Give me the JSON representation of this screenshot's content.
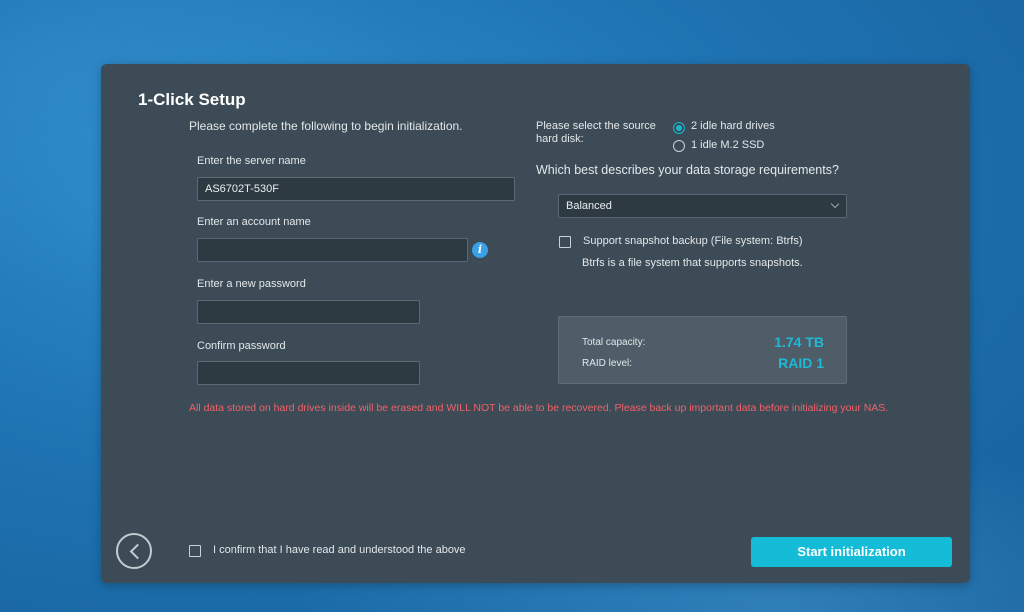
{
  "dialog": {
    "title": "1-Click Setup",
    "intro": "Please complete the following to begin initialization."
  },
  "form": {
    "server_name_label": "Enter the server name",
    "server_name_value": "AS6702T-530F",
    "account_name_label": "Enter an account name",
    "account_name_value": "",
    "password_label": "Enter a new password",
    "password_value": "",
    "confirm_password_label": "Confirm password",
    "confirm_password_value": ""
  },
  "source_disk": {
    "label": "Please select the source hard disk:",
    "options": [
      {
        "label": "2 idle hard drives",
        "selected": true
      },
      {
        "label": "1 idle M.2 SSD",
        "selected": false
      }
    ]
  },
  "storage": {
    "question": "Which best describes your data storage requirements?",
    "selected": "Balanced",
    "snapshot_label": "Support snapshot backup (File system: Btrfs)",
    "snapshot_checked": false,
    "snapshot_note": "Btrfs is a file system that supports snapshots."
  },
  "summary": {
    "capacity_label": "Total capacity:",
    "capacity_value": "1.74 TB",
    "raid_label": "RAID level:",
    "raid_value": "RAID 1"
  },
  "warning": "All data stored on hard drives inside will be erased and WILL NOT be able to be recovered. Please back up important data before initializing your NAS.",
  "footer": {
    "confirm_label": "I confirm that I have read and understood the above",
    "confirm_checked": false,
    "start_button": "Start initialization"
  },
  "icons": {
    "info": "info-icon",
    "back": "back-arrow-icon",
    "dropdown": "chevron-down-icon"
  },
  "colors": {
    "accent": "#15bcd8",
    "warning": "#f0626a",
    "panel": "#3c4b55"
  }
}
